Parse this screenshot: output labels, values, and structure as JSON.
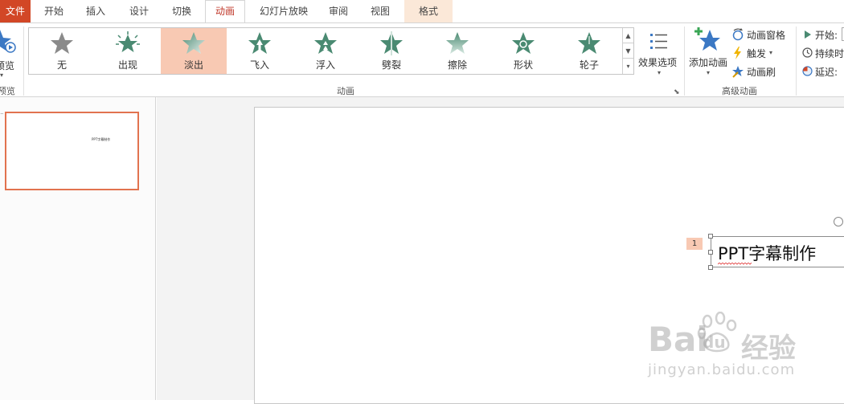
{
  "tabs": [
    {
      "id": "file",
      "label": "文件"
    },
    {
      "id": "home",
      "label": "开始"
    },
    {
      "id": "insert",
      "label": "插入"
    },
    {
      "id": "design",
      "label": "设计"
    },
    {
      "id": "transitions",
      "label": "切换"
    },
    {
      "id": "animations",
      "label": "动画"
    },
    {
      "id": "slideshow",
      "label": "幻灯片放映"
    },
    {
      "id": "review",
      "label": "审阅"
    },
    {
      "id": "view",
      "label": "视图"
    },
    {
      "id": "format",
      "label": "格式"
    }
  ],
  "preview": {
    "label": "预览",
    "group_label": "预览"
  },
  "animation_gallery": {
    "effects": [
      {
        "label": "无"
      },
      {
        "label": "出现"
      },
      {
        "label": "淡出"
      },
      {
        "label": "飞入"
      },
      {
        "label": "浮入"
      },
      {
        "label": "劈裂"
      },
      {
        "label": "擦除"
      },
      {
        "label": "形状"
      },
      {
        "label": "轮子"
      }
    ],
    "selected": "淡出",
    "group_label": "动画"
  },
  "effect_options": {
    "label": "效果选项"
  },
  "advanced": {
    "add_animation": "添加动画",
    "animation_pane": "动画窗格",
    "trigger": "触发",
    "painter": "动画刷",
    "group_label": "高级动画"
  },
  "timing": {
    "start": "开始:",
    "duration": "持续时",
    "delay": "延迟:"
  },
  "slide_thumb": {
    "text": "PPT字幕制作"
  },
  "slide": {
    "anim_order": "1",
    "textbox_text": "PPT字幕制作"
  },
  "watermark": {
    "brand": "Bai",
    "brand2": "du",
    "cn": "经验",
    "url": "jingyan.baidu.com"
  },
  "colors": {
    "accent": "#d24726",
    "selection": "#f8c9b3",
    "star_primary": "#4a8a72",
    "star_gray": "#8a8a8a",
    "add_anim_star": "#3b78c4"
  },
  "icons": {
    "effect_star": "star-icon",
    "effect_options": "effect-options-icon",
    "add_animation": "add-animation-star-icon",
    "animation_pane": "animation-pane-icon",
    "trigger": "lightning-icon",
    "painter": "animation-painter-icon",
    "start": "play-triangle-icon",
    "duration": "clock-icon",
    "delay": "delay-icon"
  }
}
